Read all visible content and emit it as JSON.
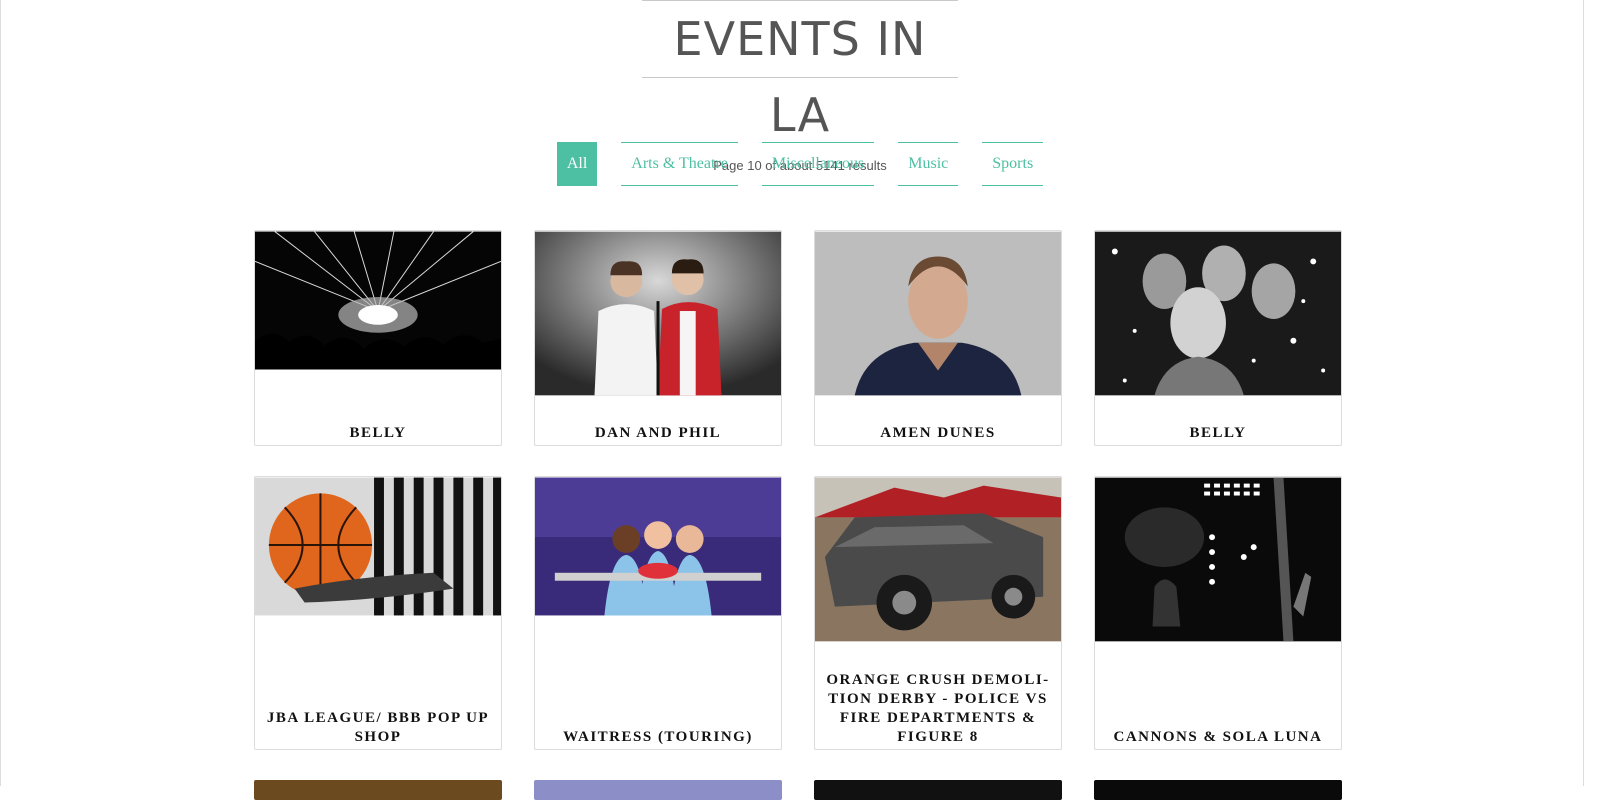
{
  "page": {
    "title": "EVENTS IN LA",
    "results_text": "Page 10 of about 5141 results"
  },
  "tabs": [
    {
      "label": "All",
      "active": true
    },
    {
      "label": "Arts & Theatre",
      "active": false
    },
    {
      "label": "Miscellaneous",
      "active": false
    },
    {
      "label": "Music",
      "active": false
    },
    {
      "label": "Sports",
      "active": false
    }
  ],
  "events": [
    {
      "title": "BELLY",
      "image": "concert-light-beams"
    },
    {
      "title": "DAN AND PHIL",
      "image": "two-men-microphone"
    },
    {
      "title": "AMEN DUNES",
      "image": "man-portrait"
    },
    {
      "title": "BELLY",
      "image": "band-portrait-bw"
    },
    {
      "title": "JBA LEAGUE/ BBB POP UP SHOP",
      "image": "basketball-referee"
    },
    {
      "title": "WAITRESS (TOURING)",
      "image": "three-waitresses-stage"
    },
    {
      "title": "ORANGE CRUSH DEMOLI-TION DERBY - POLICE VS FIRE DEPARTMENTS & FIGURE 8",
      "image": "demolition-derby-car"
    },
    {
      "title": "CANNONS & SOLA LUNA",
      "image": "concert-stage-lights"
    }
  ],
  "colors": {
    "accent": "#4dbfa3",
    "title_text": "#555555",
    "card_border": "#dcdcdc"
  }
}
